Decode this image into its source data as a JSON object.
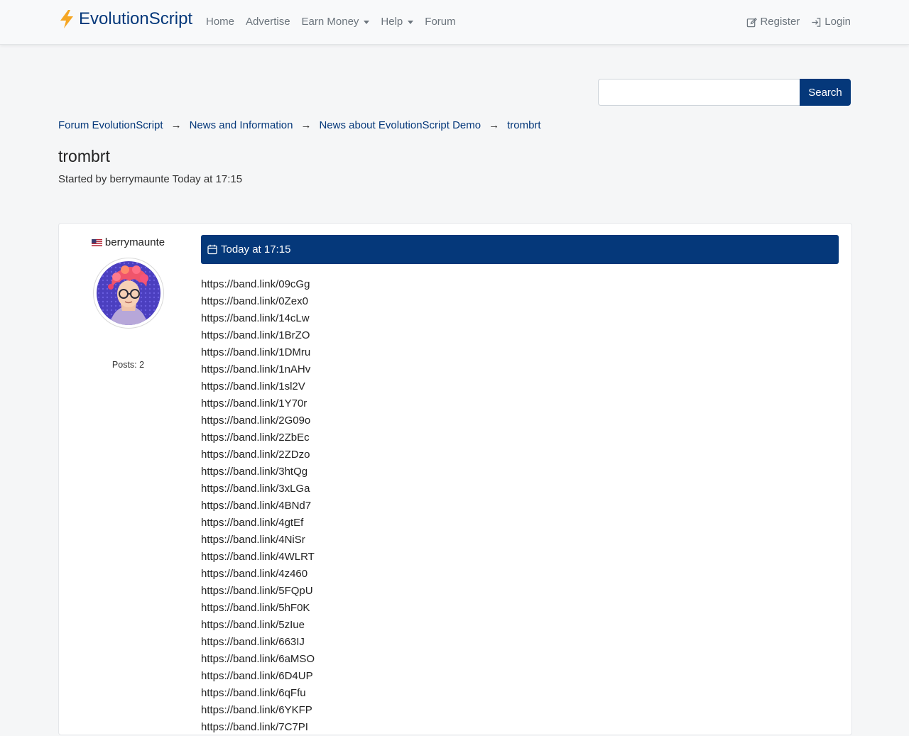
{
  "brand": {
    "name": "EvolutionScript"
  },
  "nav": {
    "home": "Home",
    "advertise": "Advertise",
    "earn_money": "Earn Money",
    "help": "Help",
    "forum": "Forum",
    "register": "Register",
    "login": "Login"
  },
  "search": {
    "value": "",
    "placeholder": "",
    "button": "Search"
  },
  "breadcrumb": {
    "c1": "Forum EvolutionScript",
    "c2": "News and Information",
    "c3": "News about EvolutionScript Demo",
    "c4": "trombrt",
    "separator": "→"
  },
  "topic": {
    "title": "trombrt",
    "meta": "Started by berrymaunte Today at 17:15"
  },
  "post": {
    "author": "berrymaunte",
    "posts": "Posts: 2",
    "date": "Today at 17:15",
    "lines": [
      "https://band.link/09cGg",
      "https://band.link/0Zex0",
      "https://band.link/14cLw",
      "https://band.link/1BrZO",
      "https://band.link/1DMru",
      "https://band.link/1nAHv",
      "https://band.link/1sl2V",
      "https://band.link/1Y70r",
      "https://band.link/2G09o",
      "https://band.link/2ZbEc",
      "https://band.link/2ZDzo",
      "https://band.link/3htQg",
      "https://band.link/3xLGa",
      "https://band.link/4BNd7",
      "https://band.link/4gtEf",
      "https://band.link/4NiSr",
      "https://band.link/4WLRT",
      "https://band.link/4z460",
      "https://band.link/5FQpU",
      "https://band.link/5hF0K",
      "https://band.link/5zIue",
      "https://band.link/663IJ",
      "https://band.link/6aMSO",
      "https://band.link/6D4UP",
      "https://band.link/6qFfu",
      "https://band.link/6YKFP",
      "https://band.link/7C7PI"
    ]
  },
  "colors": {
    "primary": "#05387a",
    "bolt": "#f5a623",
    "background": "#f5f6f7"
  },
  "icons": {
    "brand": "lightning-bolt-icon",
    "register": "pencil-square-icon",
    "login": "login-arrow-icon",
    "date": "calendar-icon",
    "flag": "us-flag-icon"
  }
}
